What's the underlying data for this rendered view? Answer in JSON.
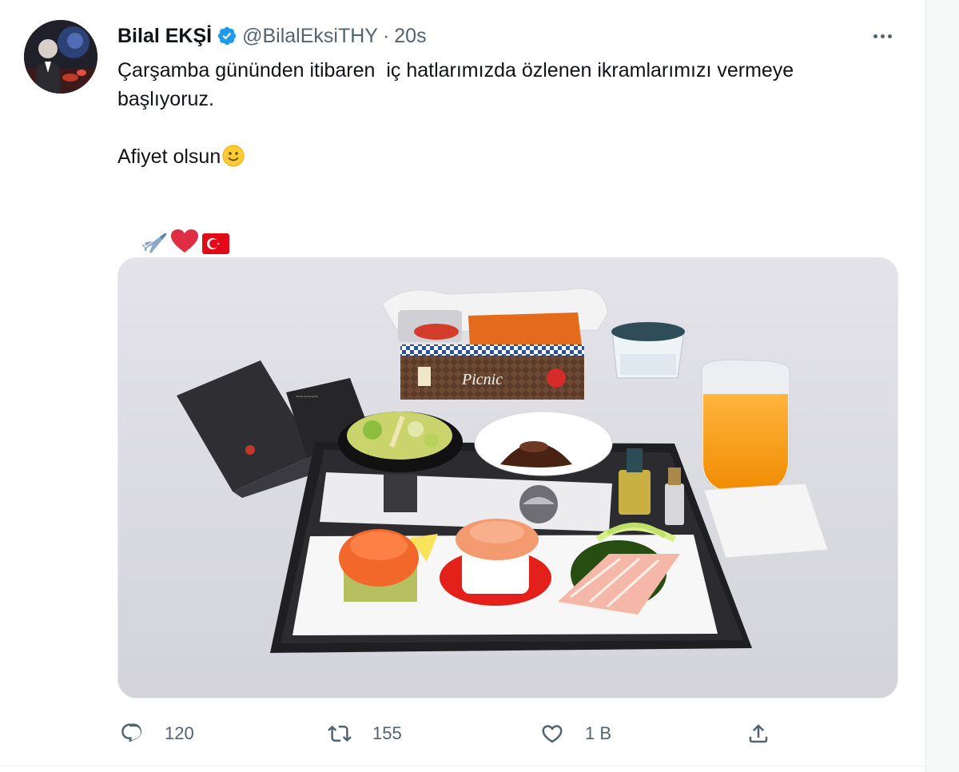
{
  "tweet": {
    "display_name": "Bilal EKŞİ",
    "verified": true,
    "handle": "@BilalEksiTHY",
    "separator": "·",
    "time": "20s",
    "text_lines": [
      "Çarşamba gününden itibaren  iç hatlarımızda özlenen ikramlarımızı vermeye",
      "başlıyoruz.",
      "Afiyet olsun"
    ],
    "emojis": [
      "slightly-smiling-face",
      "airplane",
      "red-heart",
      "turkey-flag"
    ],
    "media": {
      "picnic_box_label": "Picnic",
      "icons": [
        "meal-tray",
        "menu-card",
        "salad-bowl",
        "chocolate-dessert",
        "water-cup",
        "orange-juice-glass",
        "salmon-roll",
        "shrimp-appetizer",
        "fish-fillet"
      ]
    }
  },
  "actions": {
    "reply_count": "120",
    "retweet_count": "155",
    "like_count": "1 B",
    "icons": [
      "reply-icon",
      "retweet-icon",
      "like-icon",
      "share-icon",
      "more-icon",
      "verified-icon"
    ]
  },
  "colors": {
    "text": "#0f1419",
    "secondary": "#536471",
    "verified": "#1d9bf0",
    "border": "#eff3f4"
  }
}
